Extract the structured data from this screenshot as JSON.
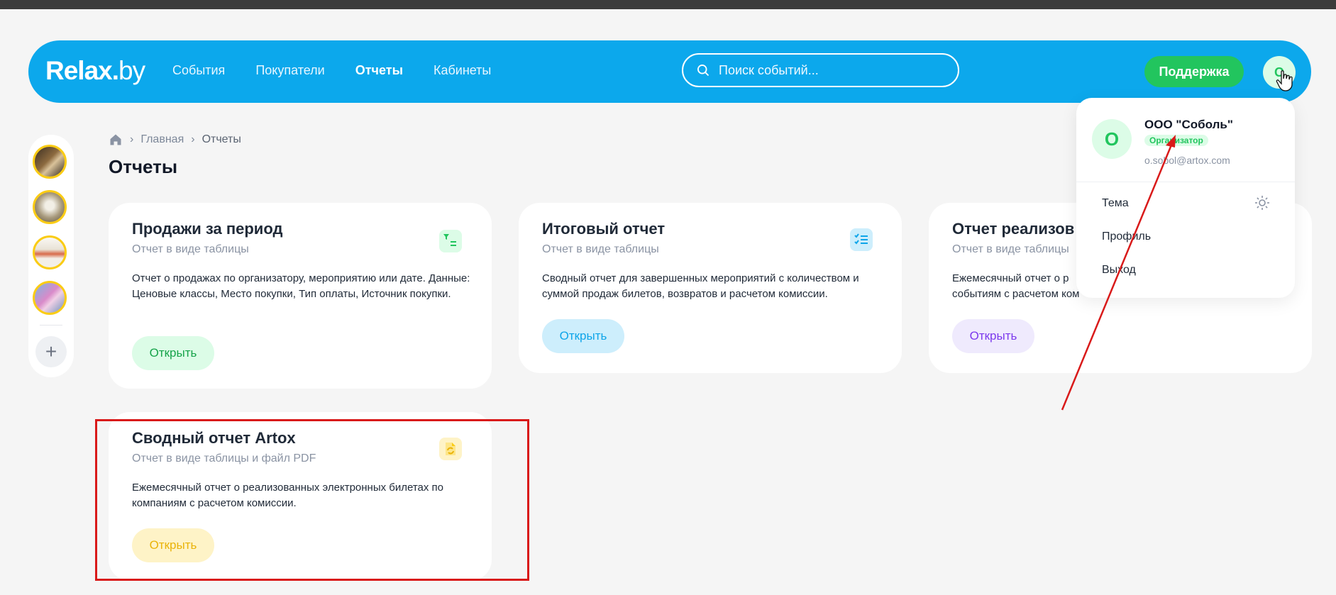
{
  "header": {
    "logo_main": "Relax",
    "logo_dot": ".",
    "logo_suffix": "by",
    "nav": [
      {
        "label": "События"
      },
      {
        "label": "Покупатели"
      },
      {
        "label": "Отчеты",
        "active": true
      },
      {
        "label": "Кабинеты"
      }
    ],
    "search_placeholder": "Поиск событий...",
    "support_label": "Поддержка",
    "avatar_letter": "О"
  },
  "colors": {
    "brand_blue": "#0ca8ec",
    "green": "#22c55e",
    "cyan": "#0ea5e9",
    "purple": "#7c3aed",
    "yellow": "#eab308",
    "highlight_red": "#d91a1a"
  },
  "breadcrumb": {
    "home_icon": "home-icon",
    "items": [
      "Главная",
      "Отчеты"
    ]
  },
  "page_title": "Отчеты",
  "cards": [
    {
      "title": "Продажи за период",
      "subtitle": "Отчет в виде таблицы",
      "desc": "Отчет о продажах по организатору, мероприятию или дате. Данные: Ценовые классы, Место покупки, Тип оплаты, Источник покупки.",
      "button": "Открыть",
      "icon": "filter-list-icon"
    },
    {
      "title": "Итоговый отчет",
      "subtitle": "Отчет в виде таблицы",
      "desc": "Сводный отчет для завершенных мероприятий с количеством и суммой продаж билетов, возвратов и расчетом комиссии.",
      "button": "Открыть",
      "icon": "checklist-icon"
    },
    {
      "title": "Отчет реализов",
      "subtitle": "Отчет в виде таблицы",
      "desc_line1": "Ежемесячный отчет о р",
      "desc_line2": "событиям с расчетом ком",
      "button": "Открыть"
    },
    {
      "title": "Сводный отчет Artox",
      "subtitle": "Отчет в виде таблицы и файл PDF",
      "desc": "Ежемесячный отчет о реализованных электронных билетах по компаниям с расчетом комиссии.",
      "button": "Открыть",
      "icon": "document-sync-icon"
    }
  ],
  "dropdown": {
    "avatar_letter": "О",
    "org_name": "ООО \"Соболь\"",
    "role": "Организатор",
    "email": "o.sobol@artox.com",
    "items": [
      "Тема",
      "Профиль",
      "Выход"
    ],
    "theme_icon": "sun-icon"
  }
}
